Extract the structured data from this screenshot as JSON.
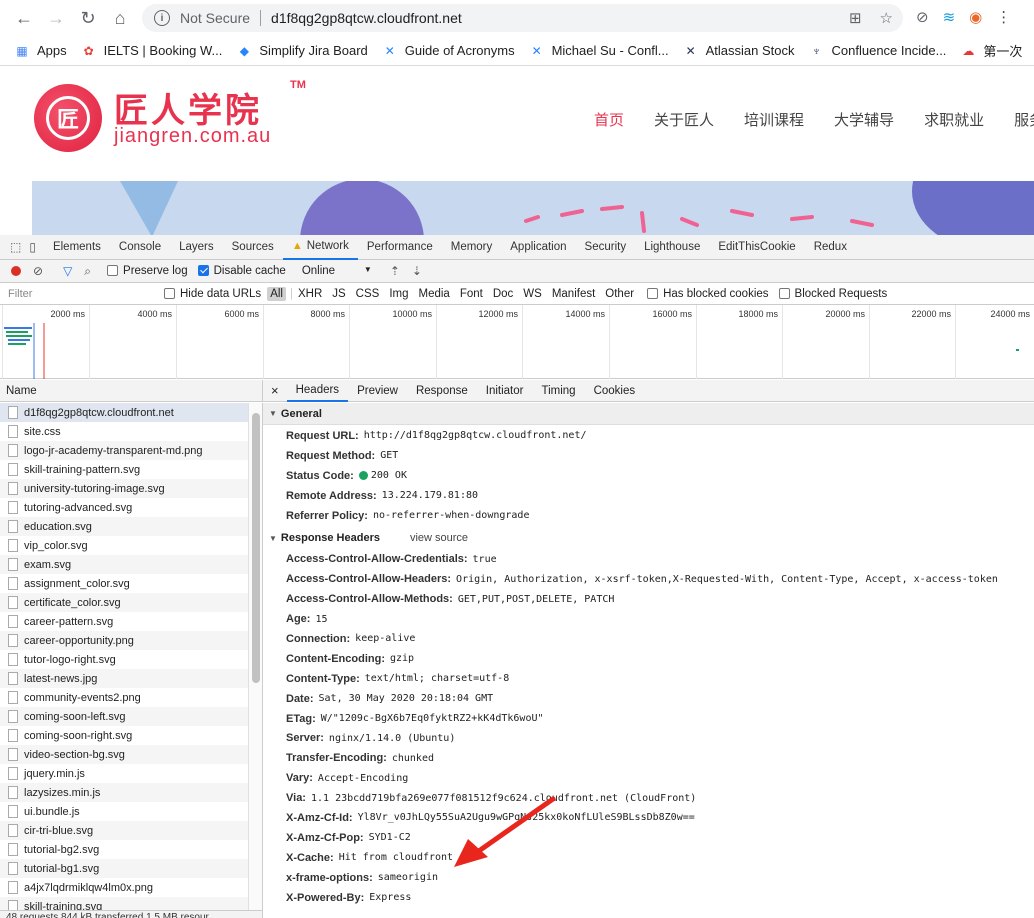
{
  "browser": {
    "security_label": "Not Secure",
    "url": "d1f8qg2gp8qtcw.cloudfront.net"
  },
  "bookmarks": [
    {
      "label": "Apps",
      "icon": "apps-grid-icon"
    },
    {
      "label": "IELTS | Booking W...",
      "icon": "ielts-icon"
    },
    {
      "label": "Simplify Jira Board",
      "icon": "jira-icon"
    },
    {
      "label": "Guide of Acronyms",
      "icon": "confluence-icon"
    },
    {
      "label": "Michael Su - Confl...",
      "icon": "confluence-icon"
    },
    {
      "label": "Atlassian Stock",
      "icon": "atlassian-icon"
    },
    {
      "label": "Confluence Incide...",
      "icon": "incident-icon"
    },
    {
      "label": "第一次",
      "icon": "cloud-icon"
    }
  ],
  "site": {
    "logo_cn": "匠人学院",
    "logo_tm": "TM",
    "logo_en": "jiangren.com.au",
    "nav": [
      "首页",
      "关于匠人",
      "培训课程",
      "大学辅导",
      "求职就业",
      "服务城"
    ]
  },
  "devtools": {
    "tabs": [
      "Elements",
      "Console",
      "Layers",
      "Sources",
      "Network",
      "Performance",
      "Memory",
      "Application",
      "Security",
      "Lighthouse",
      "EditThisCookie",
      "Redux"
    ],
    "active_tab": "Network",
    "preserve_log": "Preserve log",
    "disable_cache": "Disable cache",
    "throttle": "Online",
    "filter_placeholder": "Filter",
    "hide_data_urls": "Hide data URLs",
    "types": [
      "All",
      "XHR",
      "JS",
      "CSS",
      "Img",
      "Media",
      "Font",
      "Doc",
      "WS",
      "Manifest",
      "Other"
    ],
    "has_blocked_cookies": "Has blocked cookies",
    "blocked_requests": "Blocked Requests",
    "timeline_ticks": [
      "2000 ms",
      "4000 ms",
      "6000 ms",
      "8000 ms",
      "10000 ms",
      "12000 ms",
      "14000 ms",
      "16000 ms",
      "18000 ms",
      "20000 ms",
      "22000 ms",
      "24000 ms"
    ],
    "name_header": "Name",
    "files": [
      "d1f8qg2gp8qtcw.cloudfront.net",
      "site.css",
      "logo-jr-academy-transparent-md.png",
      "skill-training-pattern.svg",
      "university-tutoring-image.svg",
      "tutoring-advanced.svg",
      "education.svg",
      "vip_color.svg",
      "exam.svg",
      "assignment_color.svg",
      "certificate_color.svg",
      "career-pattern.svg",
      "career-opportunity.png",
      "tutor-logo-right.svg",
      "latest-news.jpg",
      "community-events2.png",
      "coming-soon-left.svg",
      "coming-soon-right.svg",
      "video-section-bg.svg",
      "jquery.min.js",
      "lazysizes.min.js",
      "ui.bundle.js",
      "cir-tri-blue.svg",
      "tutorial-bg2.svg",
      "tutorial-bg1.svg",
      "a4jx7lqdrmiklqw4lm0x.png",
      "skill-training.svg"
    ],
    "status_text": "48 requests   844 kB transferred   1.5 MB resour",
    "detail_tabs": [
      "Headers",
      "Preview",
      "Response",
      "Initiator",
      "Timing",
      "Cookies"
    ],
    "general_title": "General",
    "general": [
      {
        "k": "Request URL:",
        "v": "http://d1f8qg2gp8qtcw.cloudfront.net/"
      },
      {
        "k": "Request Method:",
        "v": "GET"
      },
      {
        "k": "Status Code:",
        "v": "200 OK"
      },
      {
        "k": "Remote Address:",
        "v": "13.224.179.81:80"
      },
      {
        "k": "Referrer Policy:",
        "v": "no-referrer-when-downgrade"
      }
    ],
    "response_title": "Response Headers",
    "view_source": "view source",
    "response_headers": [
      {
        "k": "Access-Control-Allow-Credentials:",
        "v": "true"
      },
      {
        "k": "Access-Control-Allow-Headers:",
        "v": "Origin, Authorization, x-xsrf-token,X-Requested-With, Content-Type, Accept, x-access-token"
      },
      {
        "k": "Access-Control-Allow-Methods:",
        "v": "GET,PUT,POST,DELETE, PATCH"
      },
      {
        "k": "Age:",
        "v": "15"
      },
      {
        "k": "Connection:",
        "v": "keep-alive"
      },
      {
        "k": "Content-Encoding:",
        "v": "gzip"
      },
      {
        "k": "Content-Type:",
        "v": "text/html; charset=utf-8"
      },
      {
        "k": "Date:",
        "v": "Sat, 30 May 2020 20:18:04 GMT"
      },
      {
        "k": "ETag:",
        "v": "W/\"1209c-BgX6b7Eq0fyktRZ2+kK4dTk6woU\""
      },
      {
        "k": "Server:",
        "v": "nginx/1.14.0 (Ubuntu)"
      },
      {
        "k": "Transfer-Encoding:",
        "v": "chunked"
      },
      {
        "k": "Vary:",
        "v": "Accept-Encoding"
      },
      {
        "k": "Via:",
        "v": "1.1 23bcdd719bfa269e077f081512f9c624.cloudfront.net (CloudFront)"
      },
      {
        "k": "X-Amz-Cf-Id:",
        "v": "Yl8Vr_v0JhLQy55SuA2Ugu9wGPqNs25kx0koNfLUleS9BLssDb8Z0w=="
      },
      {
        "k": "X-Amz-Cf-Pop:",
        "v": "SYD1-C2"
      },
      {
        "k": "X-Cache:",
        "v": "Hit from cloudfront"
      },
      {
        "k": "x-frame-options:",
        "v": "sameorigin"
      },
      {
        "k": "X-Powered-By:",
        "v": "Express"
      }
    ]
  }
}
